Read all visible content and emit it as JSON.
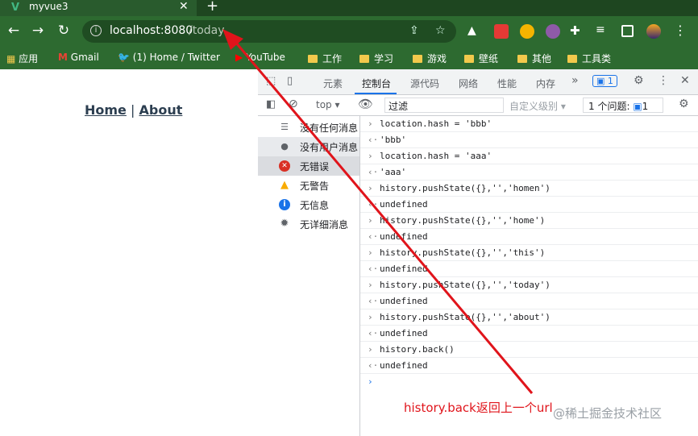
{
  "browser": {
    "tab_title": "myvue3",
    "tab_icon": "vue-logo-icon",
    "url_host": "localhost:8080",
    "url_path": "/today",
    "bookmarks": [
      {
        "label": "应用",
        "icon": "apps-grid-icon"
      },
      {
        "label": "Gmail",
        "icon": "gmail-icon"
      },
      {
        "label": "(1) Home / Twitter",
        "icon": "twitter-icon"
      },
      {
        "label": "YouTube",
        "icon": "youtube-icon"
      },
      {
        "label": "工作",
        "icon": "folder-icon"
      },
      {
        "label": "学习",
        "icon": "folder-icon"
      },
      {
        "label": "游戏",
        "icon": "folder-icon"
      },
      {
        "label": "壁纸",
        "icon": "folder-icon"
      },
      {
        "label": "其他",
        "icon": "folder-icon"
      },
      {
        "label": "工具类",
        "icon": "folder-icon"
      }
    ]
  },
  "app": {
    "nav_home": "Home",
    "nav_sep": "|",
    "nav_about": "About"
  },
  "devtools": {
    "tabs": [
      "元素",
      "控制台",
      "源代码",
      "网络",
      "性能",
      "内存"
    ],
    "active_tab": "控制台",
    "more_tabs": "»",
    "issues_badge": "1",
    "context": "top",
    "filter_placeholder": "过滤",
    "levels": "自定义级别",
    "issues_count": "1 个问题:",
    "issues_count_badge": "1",
    "sidebar": [
      {
        "label": "没有任何消息",
        "icon": "list-icon",
        "color": "#5f6368"
      },
      {
        "label": "没有用户消息",
        "icon": "user-icon",
        "color": "#5f6368"
      },
      {
        "label": "无错误",
        "icon": "error-icon",
        "color": "#d93025"
      },
      {
        "label": "无警告",
        "icon": "warning-icon",
        "color": "#f9ab00"
      },
      {
        "label": "无信息",
        "icon": "info-icon",
        "color": "#1a73e8"
      },
      {
        "label": "无详细消息",
        "icon": "gear-bug-icon",
        "color": "#5f6368"
      }
    ],
    "console_lines": [
      {
        "kind": "input",
        "text": "location.hash = 'bbb'"
      },
      {
        "kind": "output-str",
        "text": "'bbb'"
      },
      {
        "kind": "input",
        "text": "location.hash = 'aaa'"
      },
      {
        "kind": "output-str",
        "text": "'aaa'"
      },
      {
        "kind": "input",
        "text": "history.pushState({},'','homen')"
      },
      {
        "kind": "output-und",
        "text": "undefined"
      },
      {
        "kind": "input",
        "text": "history.pushState({},'','home')"
      },
      {
        "kind": "output-und",
        "text": "undefined"
      },
      {
        "kind": "input",
        "text": "history.pushState({},'','this')"
      },
      {
        "kind": "output-und",
        "text": "undefined"
      },
      {
        "kind": "input",
        "text": "history.pushState({},'','today')"
      },
      {
        "kind": "output-und",
        "text": "undefined"
      },
      {
        "kind": "input",
        "text": "history.pushState({},'','about')"
      },
      {
        "kind": "output-und",
        "text": "undefined"
      },
      {
        "kind": "input",
        "text": "history.back()"
      },
      {
        "kind": "output-und",
        "text": "undefined"
      }
    ]
  },
  "annotation": {
    "text": "history.back返回上一个url",
    "color": "#e0141b"
  },
  "watermark": "@稀土掘金技术社区"
}
